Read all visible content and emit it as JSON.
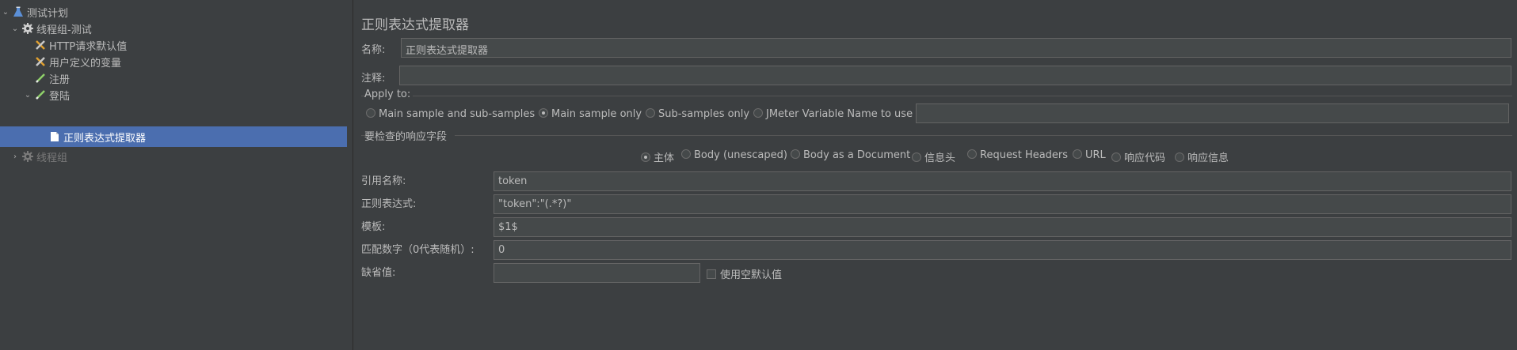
{
  "tree": {
    "items": [
      {
        "label": "测试计划",
        "icon": "flask-icon",
        "expanded": true
      },
      {
        "label": "线程组-测试",
        "icon": "gear-icon",
        "expanded": true
      },
      {
        "label": "HTTP请求默认值",
        "icon": "wrench-icon"
      },
      {
        "label": "用户定义的变量",
        "icon": "wrench-icon"
      },
      {
        "label": "注册",
        "icon": "pencil-icon"
      },
      {
        "label": "登陆",
        "icon": "pencil-icon",
        "expanded": true
      },
      {
        "label": "正则表达式提取器",
        "icon": "document-icon",
        "selected": true
      },
      {
        "label": "线程组",
        "icon": "gear-icon",
        "expanded": false,
        "disabled": true
      }
    ]
  },
  "panel": {
    "title": "正则表达式提取器",
    "name_label": "名称:",
    "name_value": "正则表达式提取器",
    "comment_label": "注释:",
    "comment_value": "",
    "apply_to": {
      "label": "Apply to:",
      "options": [
        "Main sample and sub-samples",
        "Main sample only",
        "Sub-samples only",
        "JMeter Variable Name to use"
      ],
      "selected": "Main sample only",
      "var_value": ""
    },
    "field_check": {
      "label": "要检查的响应字段",
      "options": [
        "主体",
        "Body (unescaped)",
        "Body as a Document",
        "信息头",
        "Request Headers",
        "URL",
        "响应代码",
        "响应信息"
      ],
      "selected": "主体"
    },
    "ref_label": "引用名称:",
    "ref_value": "token",
    "regex_label": "正则表达式:",
    "regex_value": "\"token\":\"(.*?)\"",
    "template_label": "模板:",
    "template_value": "$1$",
    "match_label": "匹配数字（0代表随机）:",
    "match_value": "0",
    "default_label": "缺省值:",
    "default_value": "",
    "use_empty_label": "使用空默认值"
  },
  "colors": {
    "background": "#3c3f41",
    "selection": "#4b6eaf",
    "field": "#45494a"
  }
}
